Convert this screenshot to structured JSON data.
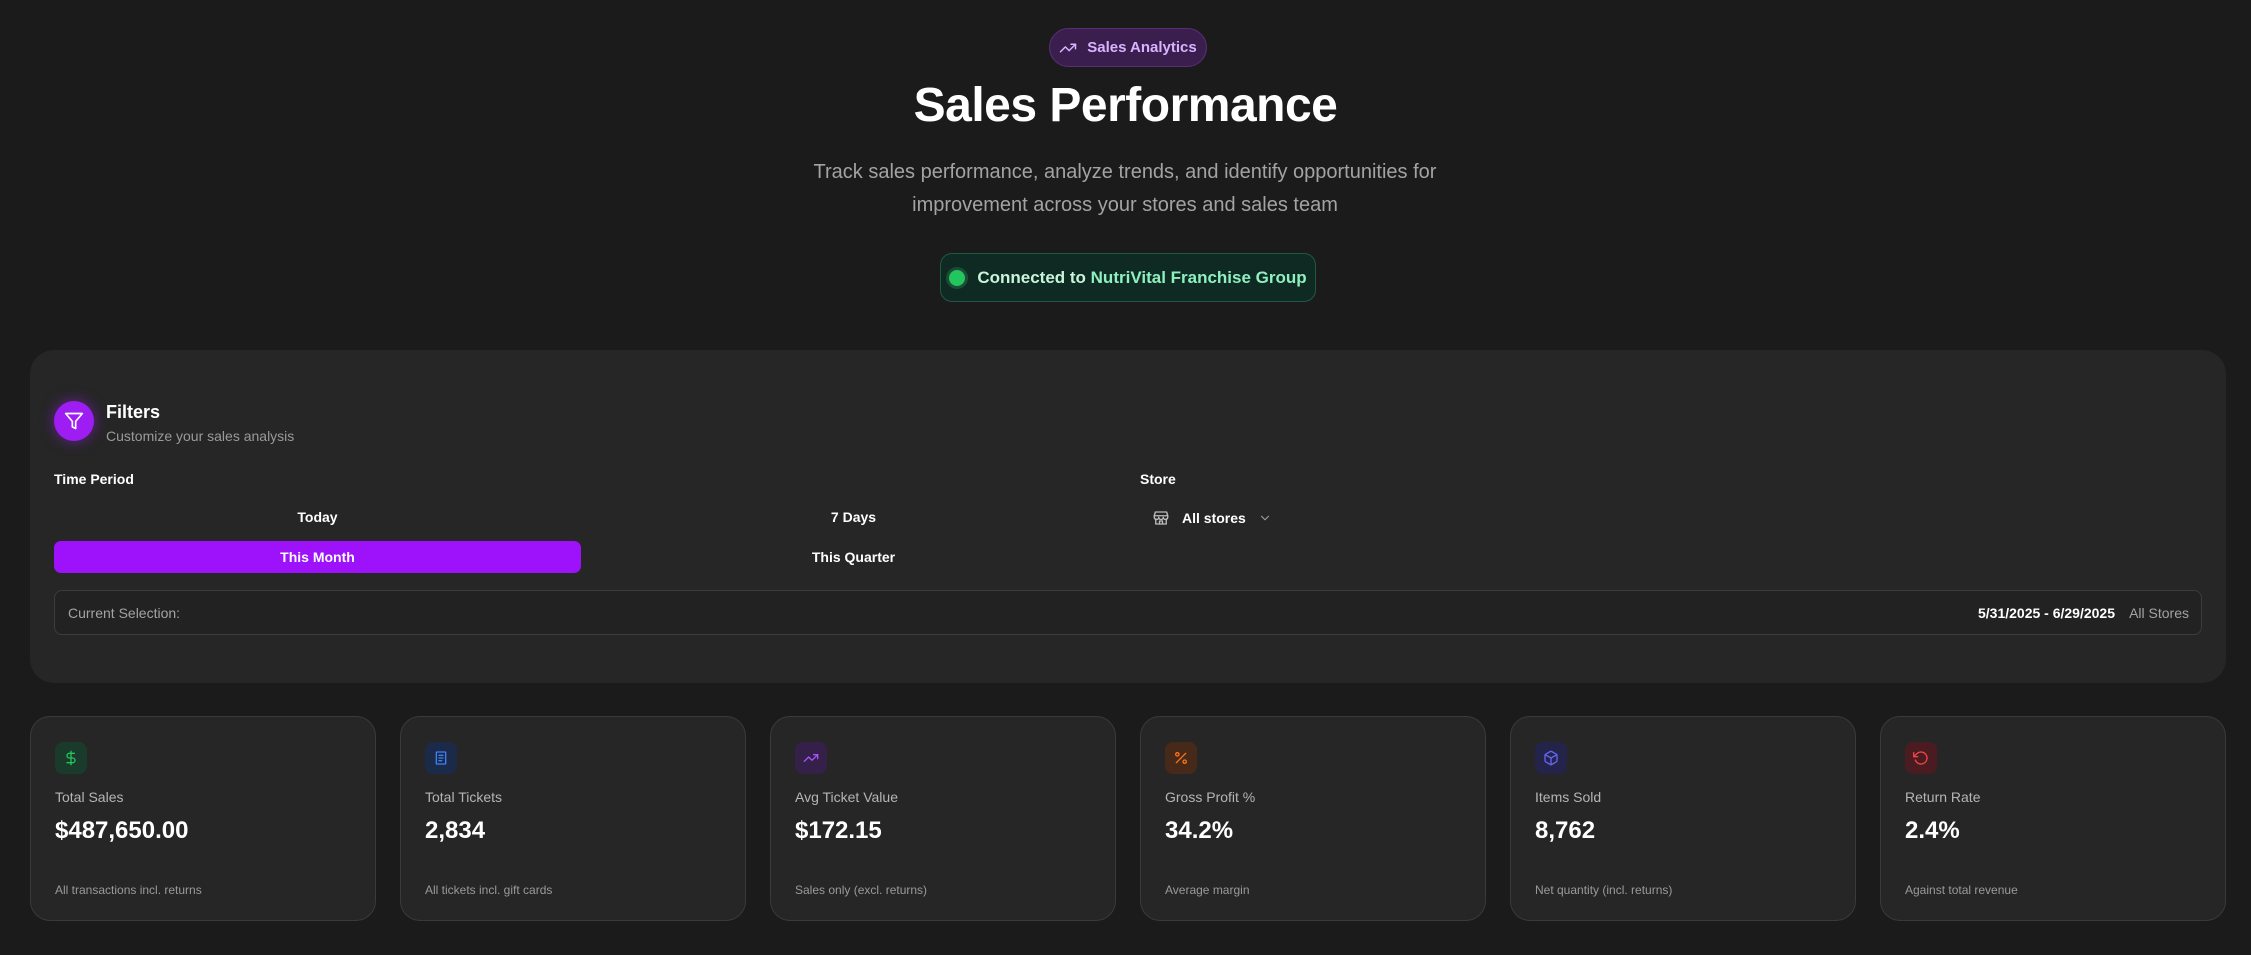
{
  "header": {
    "badge_label": "Sales Analytics",
    "title": "Sales Performance",
    "subtitle": "Track sales performance, analyze trends, and identify opportunities for improvement across your stores and sales team",
    "connection": {
      "prefix": "Connected to",
      "org": "NutriVital Franchise Group"
    }
  },
  "filters": {
    "title": "Filters",
    "subtitle": "Customize your sales analysis",
    "time_period_label": "Time Period",
    "time_options": [
      "Today",
      "7 Days",
      "This Month",
      "This Quarter"
    ],
    "selected_time": "This Month",
    "store_label": "Store",
    "store_value": "All stores",
    "current_selection_label": "Current Selection:",
    "current_range": "5/31/2025 - 6/29/2025",
    "current_store": "All Stores"
  },
  "metrics": [
    {
      "label": "Total Sales",
      "value": "$487,650.00",
      "note": "All transactions incl. returns",
      "icon": "dollar-icon",
      "color": "#22c55e"
    },
    {
      "label": "Total Tickets",
      "value": "2,834",
      "note": "All tickets incl. gift cards",
      "icon": "receipt-icon",
      "color": "#3b82f6"
    },
    {
      "label": "Avg Ticket Value",
      "value": "$172.15",
      "note": "Sales only (excl. returns)",
      "icon": "trending-up-icon",
      "color": "#a855f7"
    },
    {
      "label": "Gross Profit %",
      "value": "34.2%",
      "note": "Average margin",
      "icon": "percent-icon",
      "color": "#f97316"
    },
    {
      "label": "Items Sold",
      "value": "8,762",
      "note": "Net quantity (incl. returns)",
      "icon": "package-icon",
      "color": "#6366f1"
    },
    {
      "label": "Return Rate",
      "value": "2.4%",
      "note": "Against total revenue",
      "icon": "return-icon",
      "color": "#ef4444"
    }
  ],
  "colors": {
    "accent": "#9d12fa",
    "background": "#1b1b1b",
    "panel": "#262626",
    "success": "#22c55e"
  }
}
